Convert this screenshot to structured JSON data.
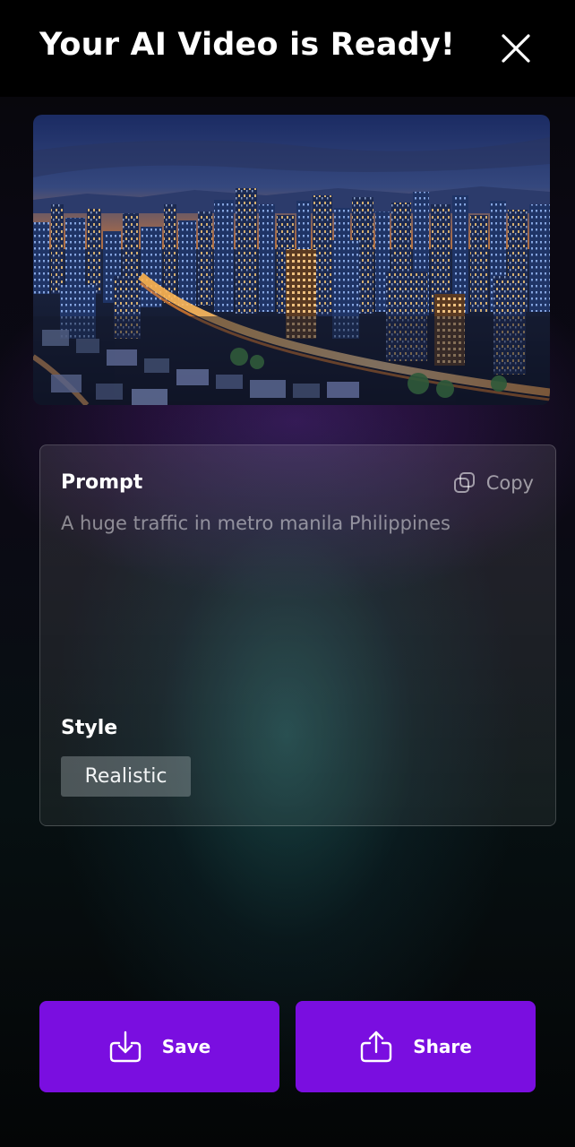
{
  "header": {
    "title": "Your AI Video is Ready!",
    "close_icon": "close-icon"
  },
  "preview": {
    "subject": "night-city-skyline"
  },
  "prompt_card": {
    "prompt_heading": "Prompt",
    "copy_label": "Copy",
    "copy_icon": "copy-icon",
    "prompt_text": "A huge traffic in metro manila Philippines",
    "style_heading": "Style",
    "style_value": "Realistic"
  },
  "actions": {
    "save_label": "Save",
    "save_icon": "download-icon",
    "share_label": "Share",
    "share_icon": "share-icon"
  },
  "colors": {
    "accent": "#7a0ee0",
    "background": "#05060a"
  }
}
